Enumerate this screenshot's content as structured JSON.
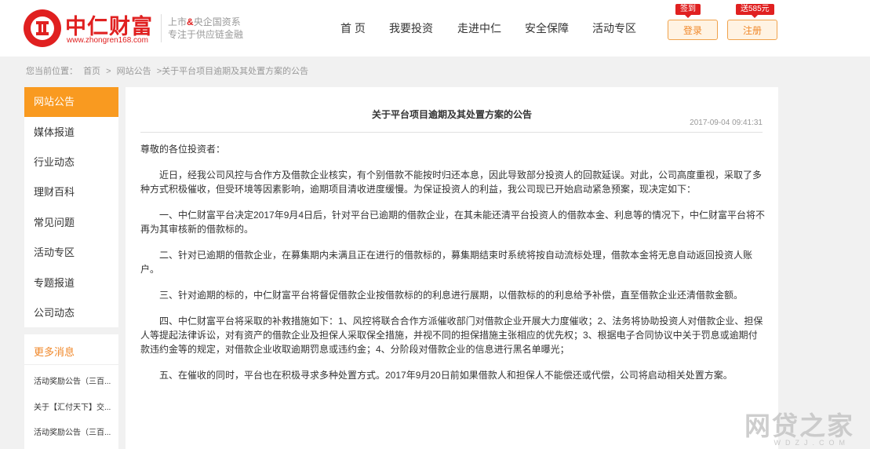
{
  "header": {
    "logo_cn": "中仁财富",
    "logo_url": "www.zhongren168.com",
    "slogan_line1_prefix": "上市",
    "slogan_line1_amp": "&",
    "slogan_line1_suffix": "央企国资系",
    "slogan_line2": "专注于供应链金融",
    "nav": [
      "首 页",
      "我要投资",
      "走进中仁",
      "安全保障",
      "活动专区"
    ],
    "login_label": "登录",
    "login_badge": "签到",
    "register_label": "注册",
    "register_badge": "送585元"
  },
  "breadcrumb": {
    "prefix": "您当前位置：",
    "items": [
      "首页",
      ">",
      "网站公告",
      ">关于平台项目逾期及其处置方案的公告"
    ]
  },
  "sidebar": {
    "items": [
      "网站公告",
      "媒体报道",
      "行业动态",
      "理财百科",
      "常见问题",
      "活动专区",
      "专题报道",
      "公司动态"
    ]
  },
  "more_news": {
    "title": "更多消息",
    "items": [
      "活动奖励公告（三百...",
      "关于【汇付天下】交...",
      "活动奖励公告（三百..."
    ]
  },
  "article": {
    "title": "关于平台项目逾期及其处置方案的公告",
    "date": "2017-09-04 09:41:31",
    "salutation": "尊敬的各位投资者：",
    "paragraphs": [
      "近日，经我公司风控与合作方及借款企业核实，有个别借款不能按时归还本息，因此导致部分投资人的回款延误。对此，公司高度重视，采取了多种方式积极催收，但受环境等因素影响，逾期项目清收进度缓慢。为保证投资人的利益，我公司现已开始启动紧急预案，现决定如下：",
      "一、中仁财富平台决定2017年9月4日后，针对平台已逾期的借款企业，在其未能还清平台投资人的借款本金、利息等的情况下，中仁财富平台将不再为其审核新的借款标的。",
      "二、针对已逾期的借款企业，在募集期内未满且正在进行的借款标的，募集期结束时系统将按自动流标处理，借款本金将无息自动返回投资人账户。",
      "三、针对逾期的标的，中仁财富平台将督促借款企业按借款标的的利息进行展期，以借款标的的利息给予补偿，直至借款企业还清借款金额。",
      "四、中仁财富平台将采取的补救措施如下：1、风控将联合合作方派催收部门对借款企业开展大力度催收；2、法务将协助投资人对借款企业、担保人等提起法律诉讼，对有资产的借款企业及担保人采取保全措施，并视不同的担保措施主张相应的优先权；3、根据电子合同协议中关于罚息或逾期付款违约金等的规定，对借款企业收取逾期罚息或违约金；4、分阶段对借款企业的信息进行黑名单曝光；",
      "五、在催收的同时，平台也在积极寻求多种处置方式。2017年9月20日前如果借款人和担保人不能偿还或代偿，公司将启动相关处置方案。"
    ]
  },
  "watermark": {
    "main": "网贷之家",
    "sub": "WDZJ.COM"
  },
  "colors": {
    "brand_red": "#e02020",
    "accent_orange": "#f99a20"
  }
}
